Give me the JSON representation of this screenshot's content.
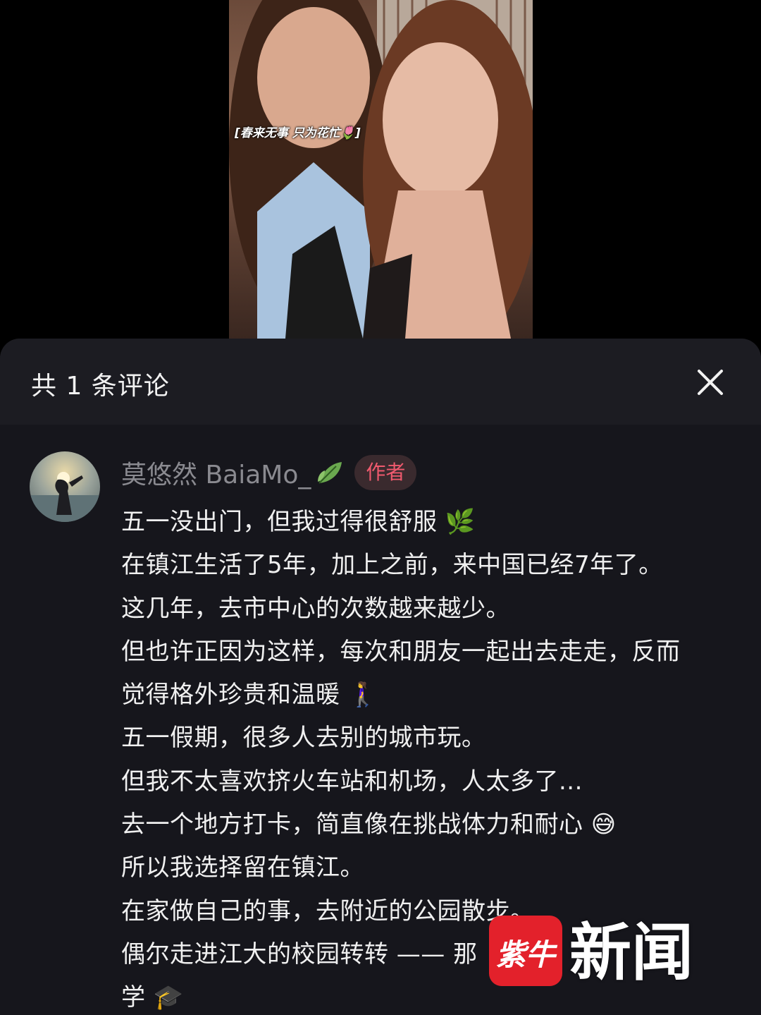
{
  "video": {
    "caption": "[春来无事 只为花忙🌷]"
  },
  "comments_panel": {
    "title": "共 1 条评论",
    "close_icon": "close-icon"
  },
  "comment": {
    "author_name": "莫悠然 BaiaMo_",
    "author_name_icon": "leaf-icon",
    "author_badge": "作者",
    "lines": [
      "五一没出门，但我过得很舒服 🌿",
      "在镇江生活了5年，加上之前，来中国已经7年了。",
      "这几年，去市中心的次数越来越少。",
      "但也许正因为这样，每次和朋友一起出去走走，反而",
      "觉得格外珍贵和温暖 🚶‍♀️",
      "五一假期，很多人去别的城市玩。",
      "但我不太喜欢挤火车站和机场，人太多了...",
      "去一个地方打卡，简直像在挑战体力和耐心 😅",
      "所以我选择留在镇江。",
      "在家做自己的事，去附近的公园散步。",
      "偶尔走进江大的校园转转 —— 那",
      "学 🎓"
    ]
  },
  "watermark": {
    "logo_text": "紫牛",
    "text": "新闻"
  },
  "colors": {
    "panel_bg": "#16161c",
    "header_bg": "#1c1c22",
    "badge_text": "#f05a6e",
    "author_name": "#8a8a90",
    "watermark_red": "#e3212b"
  }
}
